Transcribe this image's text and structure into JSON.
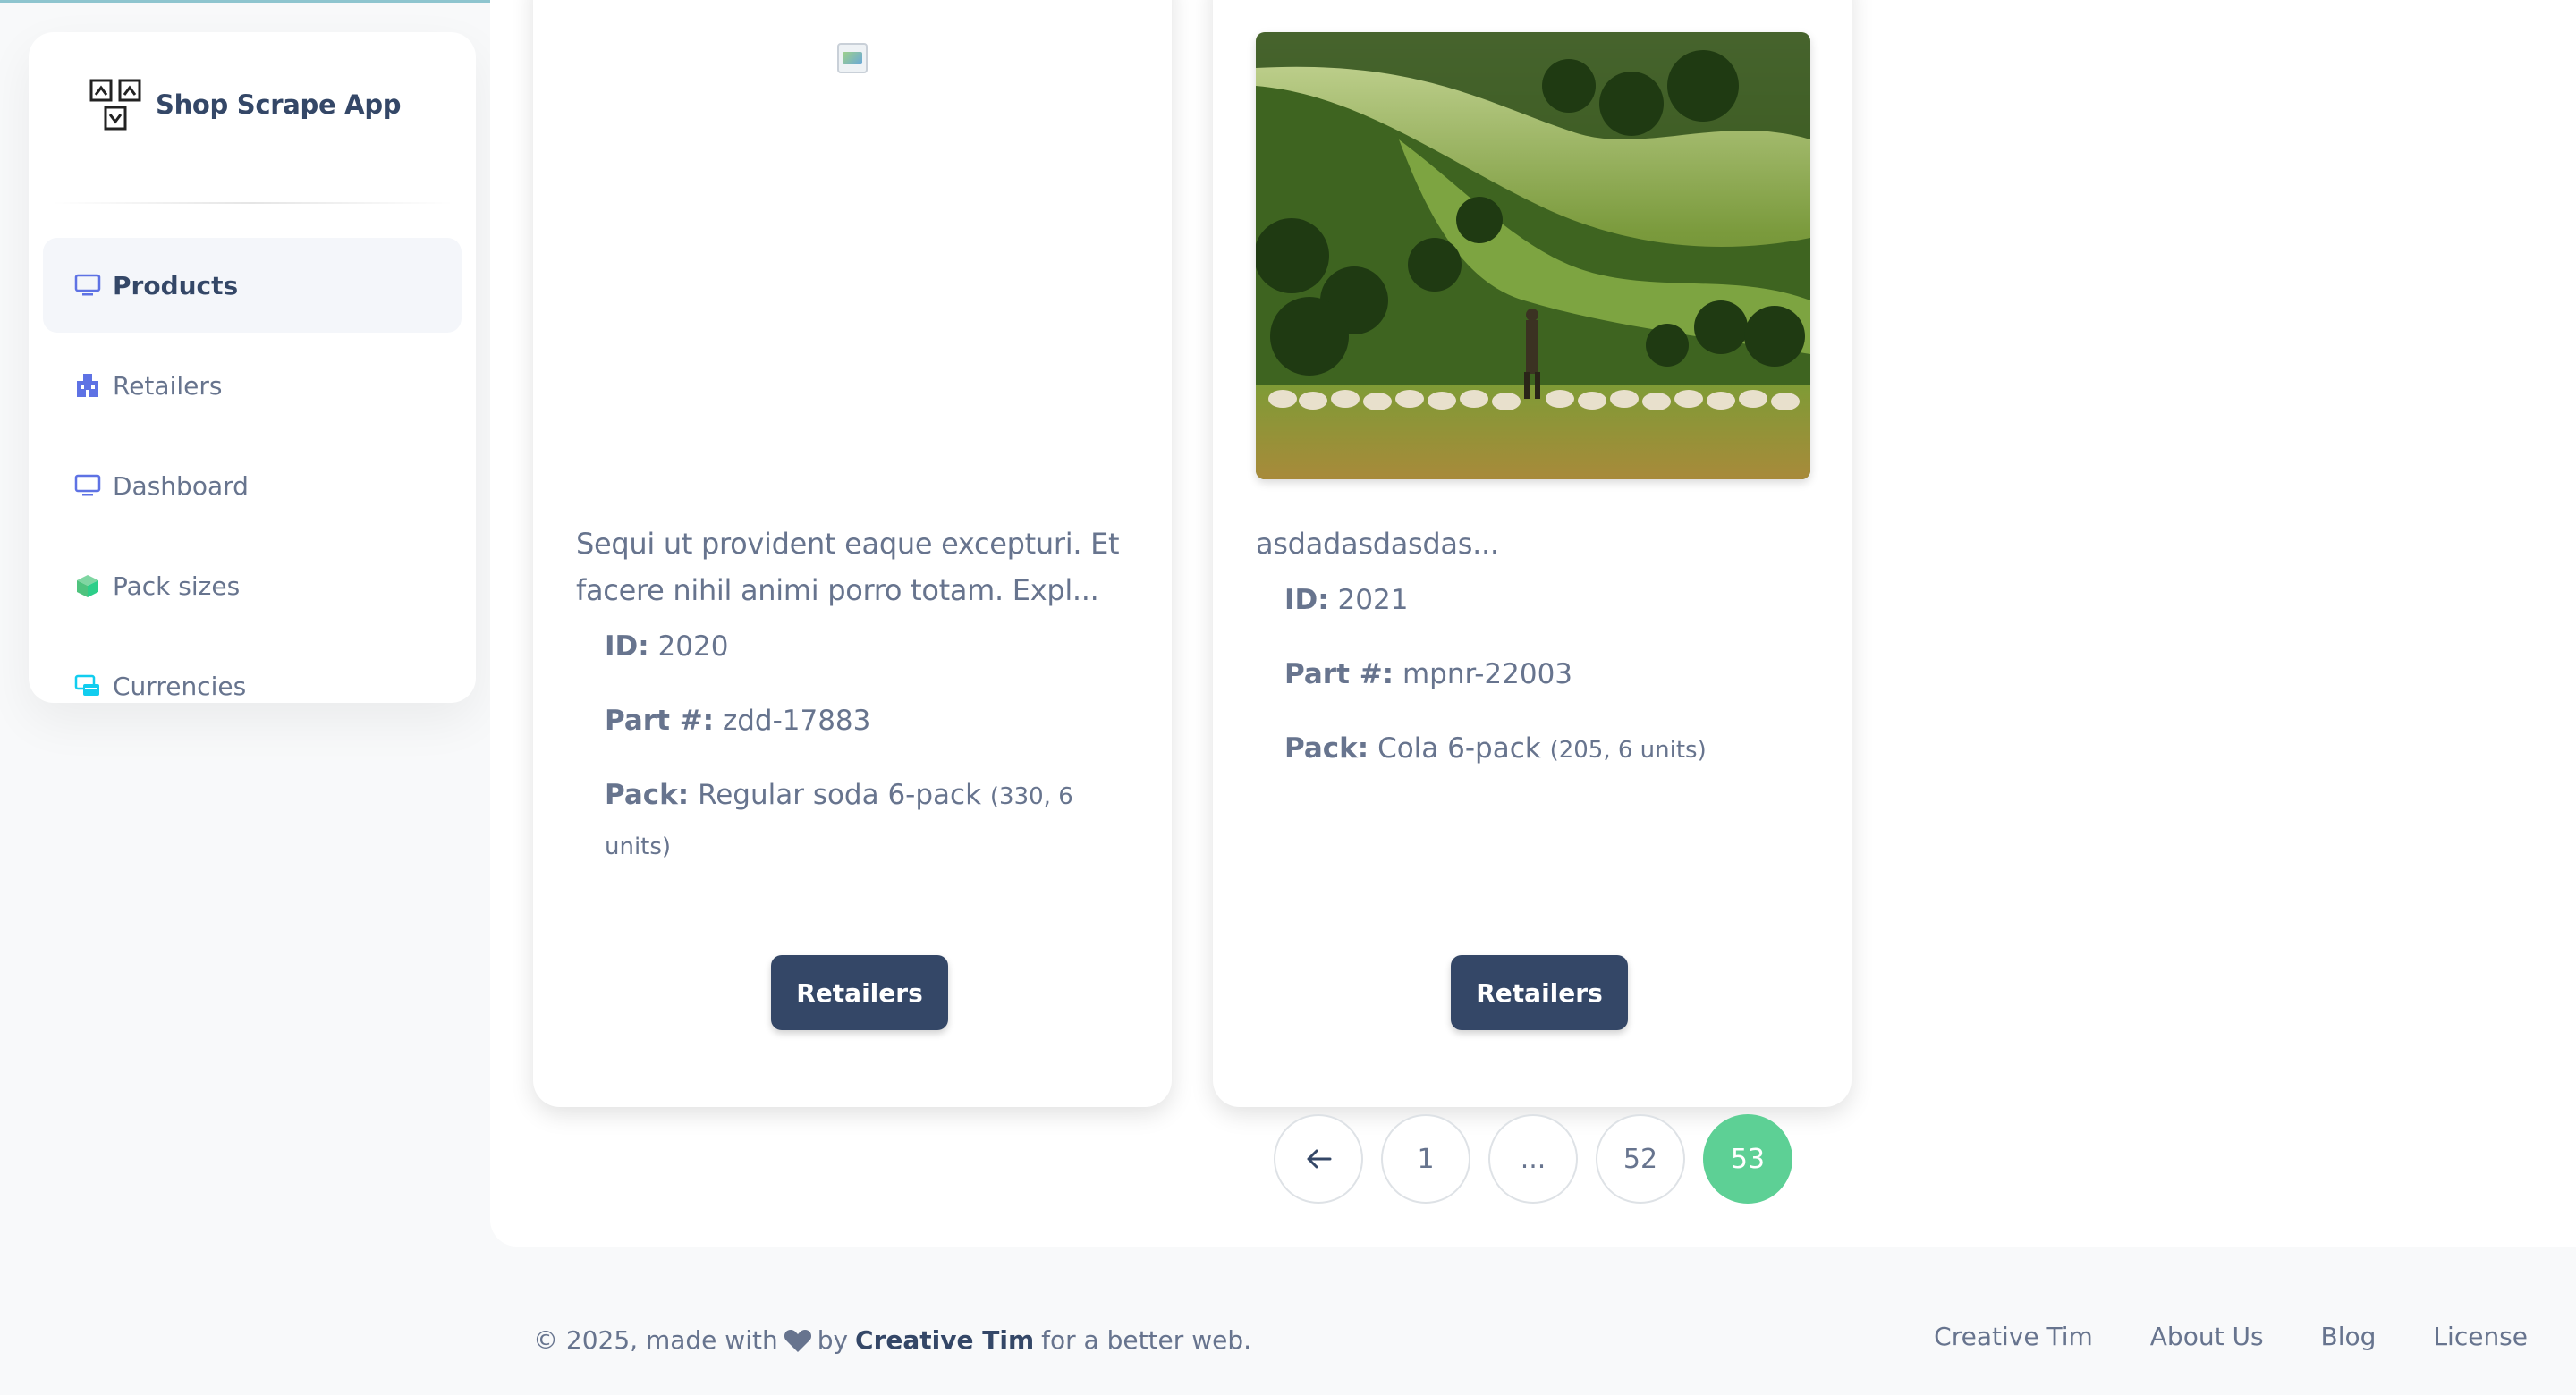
{
  "app": {
    "name": "Shop Scrape App"
  },
  "sidebar": {
    "items": [
      {
        "label": "Products",
        "icon": "monitor-icon",
        "active": true
      },
      {
        "label": "Retailers",
        "icon": "building-icon",
        "active": false
      },
      {
        "label": "Dashboard",
        "icon": "monitor-icon",
        "active": false
      },
      {
        "label": "Pack sizes",
        "icon": "box-icon",
        "active": false
      },
      {
        "label": "Currencies",
        "icon": "credit-card-icon",
        "active": false
      }
    ]
  },
  "products": [
    {
      "description": "Sequi ut provident eaque excepturi. Et facere nihil animi porro totam. Expl...",
      "id_label": "ID:",
      "id": "2020",
      "part_label": "Part #:",
      "part": "zdd-17883",
      "pack_label": "Pack:",
      "pack": "Regular soda 6-pack",
      "pack_detail": "(330, 6 units)",
      "button": "Retailers"
    },
    {
      "description": "asdadasdasdas...",
      "id_label": "ID:",
      "id": "2021",
      "part_label": "Part #:",
      "part": "mpnr-22003",
      "pack_label": "Pack:",
      "pack": "Cola 6-pack",
      "pack_detail": "(205, 6 units)",
      "button": "Retailers"
    }
  ],
  "pagination": {
    "prev_icon": "arrow-left-icon",
    "pages": [
      "1",
      "...",
      "52",
      "53"
    ],
    "active": "53"
  },
  "footer": {
    "prefix": "© 2025, made with",
    "by": "by",
    "author": "Creative Tim",
    "suffix": "for a better web.",
    "links": [
      "Creative Tim",
      "About Us",
      "Blog",
      "License"
    ]
  },
  "colors": {
    "primary": "#344767",
    "accent": "#5dd095",
    "text": "#67748e"
  }
}
